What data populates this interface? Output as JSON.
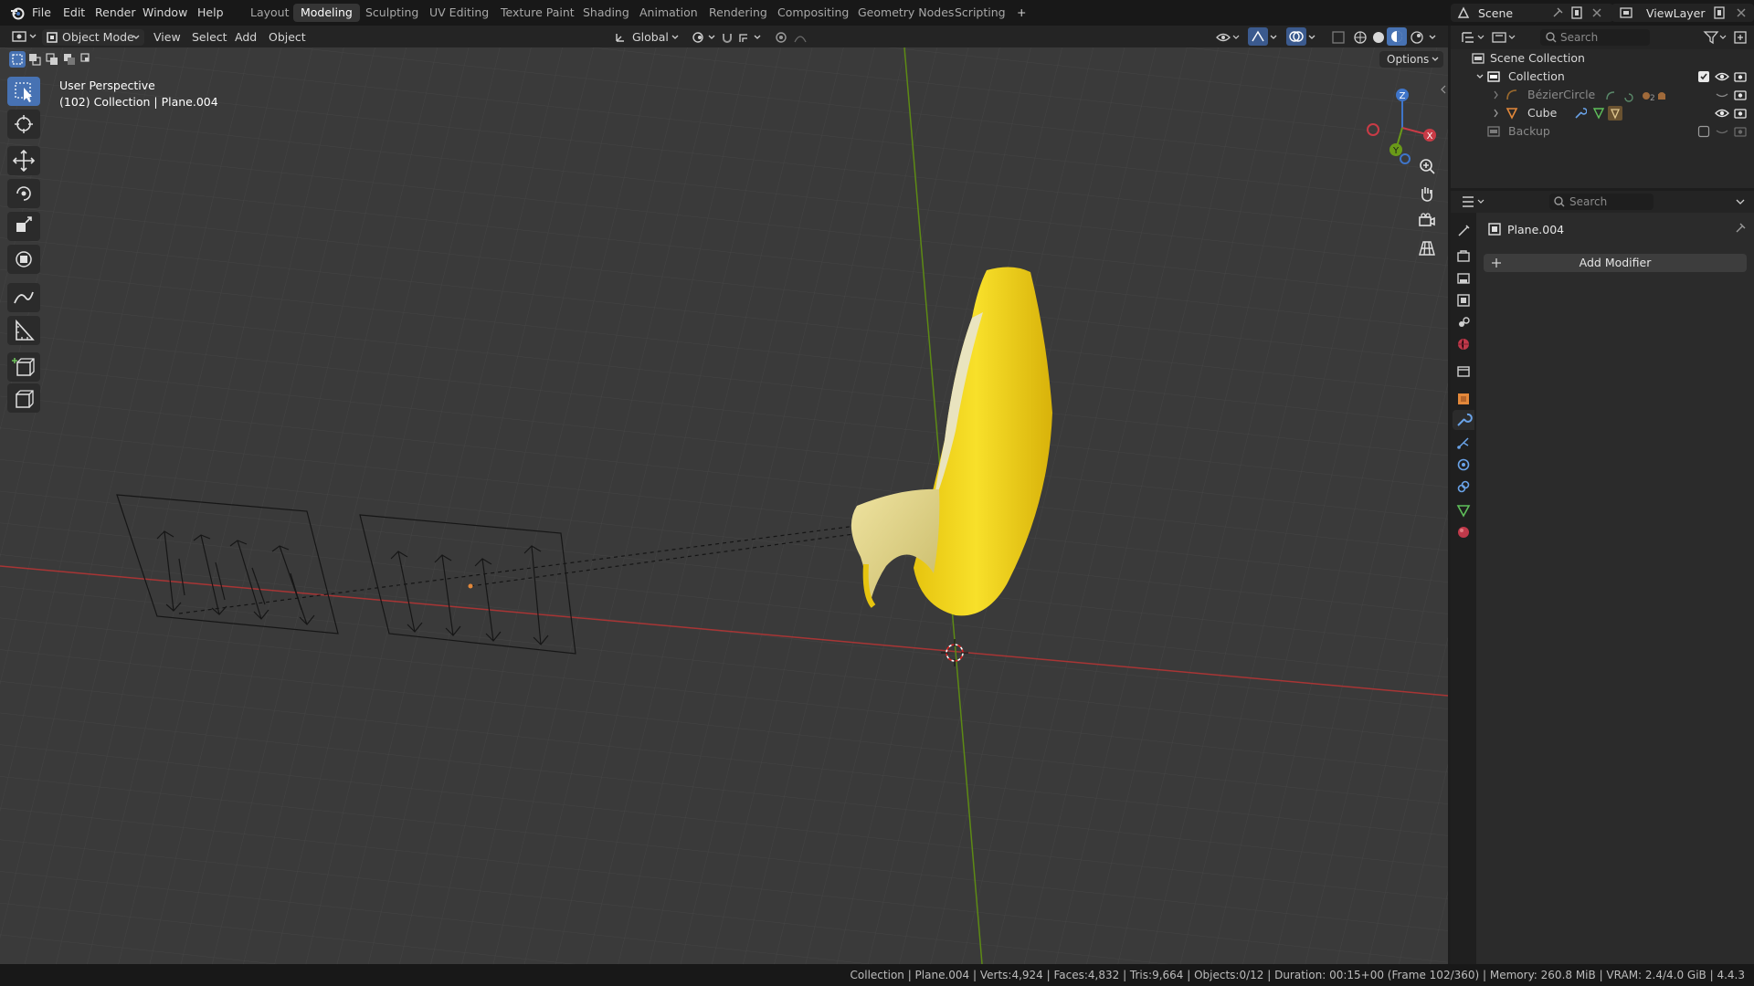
{
  "menu": {
    "items": [
      "File",
      "Edit",
      "Render",
      "Window",
      "Help"
    ],
    "workspaces": [
      "Layout",
      "Modeling",
      "Sculpting",
      "UV Editing",
      "Texture Paint",
      "Shading",
      "Animation",
      "Rendering",
      "Compositing",
      "Geometry Nodes",
      "Scripting"
    ],
    "active_workspace": "Modeling",
    "add_workspace": "+"
  },
  "scene": {
    "name": "Scene",
    "view_layer": "ViewLayer"
  },
  "viewport_header": {
    "mode": "Object Mode",
    "menus": [
      "View",
      "Select",
      "Add",
      "Object"
    ],
    "transform_orientation": "Global",
    "options": "Options"
  },
  "viewport": {
    "perspective": "User Perspective",
    "context": "(102) Collection | Plane.004",
    "gizmo": {
      "x": "X",
      "y": "Y",
      "z": "Z"
    }
  },
  "outliner": {
    "search_placeholder": "Search",
    "rows": [
      {
        "label": "Scene Collection"
      },
      {
        "label": "Collection"
      },
      {
        "label": "BézierCircle",
        "badge": "2"
      },
      {
        "label": "Cube"
      },
      {
        "label": "Backup"
      }
    ]
  },
  "properties": {
    "search_placeholder": "Search",
    "object_name": "Plane.004",
    "add_modifier": "Add Modifier"
  },
  "status": {
    "text": "Collection | Plane.004 | Verts:4,924 | Faces:4,832 | Tris:9,664 | Objects:0/12 | Duration: 00:15+00 (Frame 102/360) | Memory: 260.8 MiB | VRAM: 2.4/4.0 GiB | 4.4.3"
  },
  "colors": {
    "accent": "#4772b3",
    "axis_x": "#c13b3b",
    "axis_y": "#6a9a18",
    "banana": "#f2d21a",
    "orange": "#e3883a"
  }
}
